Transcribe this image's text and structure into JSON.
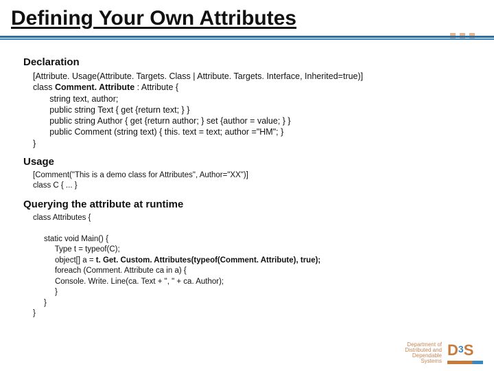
{
  "title": "Defining Your Own Attributes",
  "sections": {
    "declaration": {
      "heading": "Declaration",
      "lines": {
        "l1a": "[Attribute. Usage(Attribute. Targets. Class | Attribute. Targets. Interface, Inherited=true)]",
        "l2a": "class ",
        "l2b": "Comment. Attribute",
        "l2c": " : Attribute {",
        "l3": "       string text, author;",
        "l4": "       public string Text { get {return text; } }",
        "l5": "       public string Author { get {return author; } set {author = value; } }",
        "l6": "       public Comment (string text) { this. text = text; author =\"HM\"; }",
        "l7": "}"
      }
    },
    "usage": {
      "heading": "Usage",
      "lines": {
        "l1": "[Comment(\"This is a demo class for Attributes\", Author=\"XX\")]",
        "l2": "class C { ... }"
      }
    },
    "querying": {
      "heading": "Querying the attribute at runtime",
      "lines": {
        "l1": "class Attributes {",
        "l2": "     static void Main() {",
        "l3": "          Type t = typeof(C);",
        "l4a": "          object[] a = ",
        "l4b": "t. Get. Custom. Attributes(typeof(Comment. Attribute), true);",
        "l5": "          foreach (Comment. Attribute ca in a) {",
        "l6": "          Console. Write. Line(ca. Text + \", \" + ca. Author);",
        "l7": "          }",
        "l8": "     }",
        "l9": "}"
      }
    }
  },
  "footer": {
    "line1": "Department of",
    "line2": "Distributed and",
    "line3": "Dependable",
    "line4": "Systems"
  },
  "logo": {
    "d": "D",
    "three": "3",
    "s": "S"
  }
}
